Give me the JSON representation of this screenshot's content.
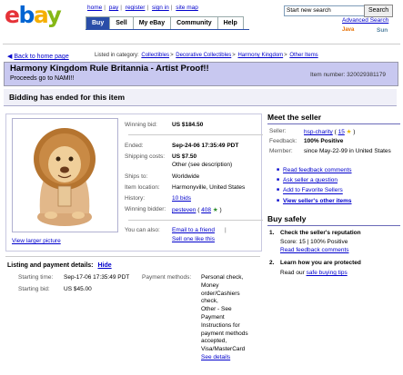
{
  "header": {
    "logo": {
      "e": "e",
      "b": "b",
      "a": "a",
      "y": "y"
    },
    "top_links": [
      "home",
      "pay",
      "register",
      "sign in",
      "site map"
    ],
    "nav_tabs": [
      "Buy",
      "Sell",
      "My eBay",
      "Community",
      "Help"
    ],
    "search_placeholder": "Start new search",
    "search_button": "Search",
    "advanced_search": "Advanced Search",
    "java_badge": "Java",
    "sun_badge": "Sun"
  },
  "breadcrumb": {
    "back_link": "Back to home page",
    "listed_in": "Listed in category:",
    "categories": [
      "Collectibles",
      "Decorative Collectibles",
      "Harmony Kingdom",
      "Other Items"
    ],
    "separator": ">"
  },
  "item": {
    "title": "Harmony Kingdom Rule Britannia - Artist Proof!!",
    "subtitle": "Proceeds go to NAMI!!",
    "item_number": "Item number: 320029381179",
    "status": "Bidding has ended for this item",
    "view_larger": "View larger picture",
    "details": [
      {
        "label": "Winning bid:",
        "value": "US $184.50",
        "bold": true
      },
      {
        "label": "Ended:",
        "value": "Sep-24-06 17:35:49 PDT",
        "bold": true
      },
      {
        "label": "Shipping costs:",
        "value": "US $7.50",
        "bold": true,
        "extra": "Other (see description)"
      },
      {
        "label": "Ships to:",
        "value": "Worldwide"
      },
      {
        "label": "Item location:",
        "value": "Harmonyville, United States"
      },
      {
        "label": "History:",
        "value": "10 bids",
        "link": true
      },
      {
        "label": "Winning bidder:",
        "value": "pesteven",
        "link": true,
        "extra": "408"
      }
    ],
    "you_can_also": "You can also:",
    "email_friend": "Email to a friend",
    "sell_one": "Sell one like this"
  },
  "listing": {
    "header": "Listing and payment details:",
    "hide": "Hide",
    "starting_time_label": "Starting time:",
    "starting_time": "Sep-17-06 17:35:49 PDT",
    "starting_bid_label": "Starting bid:",
    "starting_bid": "US $45.00",
    "payment_methods_label": "Payment methods:",
    "payment_methods": [
      "Personal check,",
      "Money",
      "order/Cashiers",
      "check,",
      "Other - See",
      "Payment",
      "Instructions for",
      "payment methods",
      "accepted,",
      "Visa/MasterCard"
    ],
    "see_details": "See details"
  },
  "seller": {
    "title": "Meet the seller",
    "seller_label": "Seller:",
    "seller_name": "hsp-charity",
    "seller_score": "15",
    "feedback_label": "Feedback:",
    "feedback": "100% Positive",
    "member_label": "Member:",
    "member_since": "since May-22-99 in United States",
    "links": [
      "Read feedback comments",
      "Ask seller a question",
      "Add to Favorite Sellers",
      "View seller's other items"
    ]
  },
  "safety": {
    "title": "Buy safely",
    "step1_title": "Check the seller's reputation",
    "step1_score": "Score: 15 | 100% Positive",
    "step1_link": "Read feedback comments",
    "step2_title": "Learn how you are protected",
    "step2_text": "Read our",
    "step2_link": "safe buying tips"
  },
  "colors": {
    "title_bar": "#c8c8f0",
    "nav_active": "#2a4ea8",
    "link": "#0000cc"
  }
}
